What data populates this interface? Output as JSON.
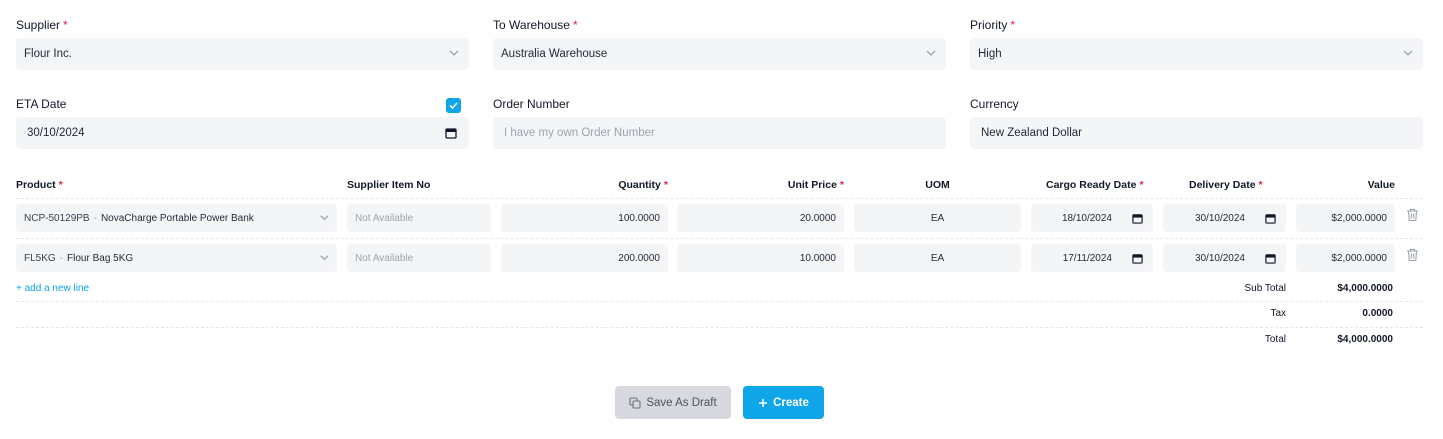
{
  "form": {
    "supplier": {
      "label": "Supplier",
      "required": "*",
      "value": "Flour Inc."
    },
    "to_warehouse": {
      "label": "To Warehouse",
      "required": "*",
      "value": "Australia Warehouse"
    },
    "priority": {
      "label": "Priority",
      "required": "*",
      "value": "High"
    },
    "eta_date": {
      "label": "ETA Date",
      "value": "30/10/2024",
      "checked": true
    },
    "order_number": {
      "label": "Order Number",
      "placeholder": "I have my own Order Number"
    },
    "currency": {
      "label": "Currency",
      "value": "New Zealand Dollar"
    }
  },
  "table": {
    "headers": {
      "product": "Product",
      "supplier_item_no": "Supplier Item No",
      "quantity": "Quantity",
      "unit_price": "Unit Price",
      "uom": "UOM",
      "cargo_ready_date": "Cargo Ready Date",
      "delivery_date": "Delivery Date",
      "value": "Value"
    },
    "required_mark": "*",
    "rows": [
      {
        "product_code": "NCP-50129PB",
        "product_sep": "-",
        "product_name": "NovaCharge Portable Power Bank",
        "supplier_item_no": "Not Available",
        "quantity": "100.0000",
        "unit_price": "20.0000",
        "uom": "EA",
        "cargo_ready_date": "18/10/2024",
        "delivery_date": "30/10/2024",
        "value": "$2,000.0000"
      },
      {
        "product_code": "FL5KG",
        "product_sep": "-",
        "product_name": "Flour Bag 5KG",
        "supplier_item_no": "Not Available",
        "quantity": "200.0000",
        "unit_price": "10.0000",
        "uom": "EA",
        "cargo_ready_date": "17/11/2024",
        "delivery_date": "30/10/2024",
        "value": "$2,000.0000"
      }
    ],
    "add_line": "+ add a new line"
  },
  "totals": {
    "sub_total_label": "Sub Total",
    "sub_total": "$4,000.0000",
    "tax_label": "Tax",
    "tax": "0.0000",
    "total_label": "Total",
    "total": "$4,000.0000"
  },
  "actions": {
    "save_draft": "Save As Draft",
    "create": "Create"
  },
  "colors": {
    "accent": "#0ea5e9",
    "required": "#e11d48",
    "field_bg": "#f4f5f7"
  },
  "icons": [
    "chevron-down-icon",
    "calendar-icon",
    "check-icon",
    "trash-icon",
    "copy-icon",
    "plus-icon"
  ]
}
